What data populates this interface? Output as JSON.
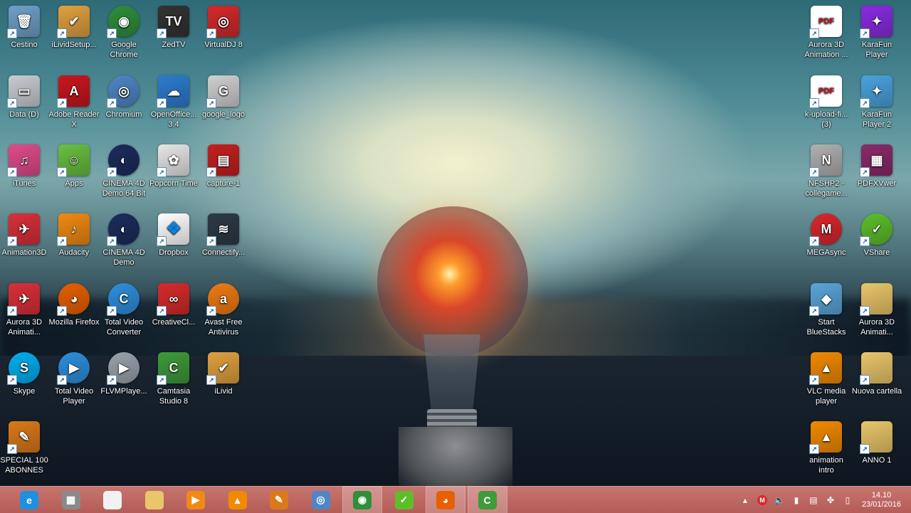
{
  "desktop": {
    "left_icons": [
      {
        "label": "Cestino",
        "icon": "recycle-bin-icon",
        "color": "#6fa0c8"
      },
      {
        "label": "iLividSetup...",
        "icon": "ilivid-icon",
        "color": "#e0a040"
      },
      {
        "label": "Google Chrome",
        "icon": "chrome-icon",
        "color": "#2f8f3a"
      },
      {
        "label": "ZedTV",
        "icon": "zedtv-icon",
        "color": "#333333"
      },
      {
        "label": "VirtualDJ 8",
        "icon": "virtualdj-icon",
        "color": "#d42a2a"
      },
      {
        "label": "Data (D)",
        "icon": "drive-icon",
        "color": "#c8ccd2"
      },
      {
        "label": "Adobe Reader X",
        "icon": "adobe-reader-icon",
        "color": "#c8171e"
      },
      {
        "label": "Chromium",
        "icon": "chromium-icon",
        "color": "#4f86c6"
      },
      {
        "label": "OpenOffice... 3.4",
        "icon": "openoffice-icon",
        "color": "#2d7ccf"
      },
      {
        "label": "google_logo",
        "icon": "image-file-icon",
        "color": "#d0d0d0"
      },
      {
        "label": "iTunes",
        "icon": "itunes-icon",
        "color": "#e04c8a"
      },
      {
        "label": "Apps",
        "icon": "android-apps-icon",
        "color": "#6abf3f"
      },
      {
        "label": "CINEMA 4D Demo 64 Bit",
        "icon": "cinema4d-icon",
        "color": "#1c2c5c"
      },
      {
        "label": "Popcorn Time",
        "icon": "popcorn-icon",
        "color": "#e6e6e6"
      },
      {
        "label": "capture-1",
        "icon": "video-file-icon",
        "color": "#c42020"
      },
      {
        "label": "Animation3D",
        "icon": "animation3d-icon",
        "color": "#d9303a"
      },
      {
        "label": "Audacity",
        "icon": "audacity-icon",
        "color": "#f08a12"
      },
      {
        "label": "CINEMA 4D Demo",
        "icon": "cinema4d-icon",
        "color": "#1c2c5c"
      },
      {
        "label": "Dropbox",
        "icon": "dropbox-icon",
        "color": "#ffffff"
      },
      {
        "label": "Connectify...",
        "icon": "connectify-icon",
        "color": "#2e3a46"
      },
      {
        "label": "Aurora 3D Animati...",
        "icon": "aurora3d-icon",
        "color": "#d9303a"
      },
      {
        "label": "Mozilla Firefox",
        "icon": "firefox-icon",
        "color": "#e66000"
      },
      {
        "label": "Total Video Converter",
        "icon": "total-video-converter-icon",
        "color": "#2e8fdc"
      },
      {
        "label": "CreativeCl...",
        "icon": "creative-cloud-icon",
        "color": "#d62b2b"
      },
      {
        "label": "Avast Free Antivirus",
        "icon": "avast-icon",
        "color": "#f07a13"
      },
      {
        "label": "Skype",
        "icon": "skype-icon",
        "color": "#00aff0"
      },
      {
        "label": "Total Video Player",
        "icon": "total-video-player-icon",
        "color": "#2e8fdc"
      },
      {
        "label": "FLVMPlaye...",
        "icon": "flv-player-icon",
        "color": "#9aa3ad"
      },
      {
        "label": "Camtasia Studio 8",
        "icon": "camtasia-icon",
        "color": "#3e9b3a"
      },
      {
        "label": "iLivid",
        "icon": "ilivid-icon",
        "color": "#e0a040"
      },
      {
        "label": "SPECIAL 100 ABONNES",
        "icon": "video-tool-icon",
        "color": "#d97a1a"
      }
    ],
    "right_icons": [
      {
        "label": "Aurora 3D Animation ...",
        "icon": "pdf-file-icon",
        "color": "#c8171e"
      },
      {
        "label": "KaraFun Player",
        "icon": "karafun-icon",
        "color": "#8a2be2"
      },
      {
        "label": "k-upload-fi... (3)",
        "icon": "pdf-file-icon",
        "color": "#c8171e"
      },
      {
        "label": "KaraFun Player 2",
        "icon": "karafun-icon",
        "color": "#4aa3df"
      },
      {
        "label": "NFSHP2 - collegame...",
        "icon": "nfs-icon",
        "color": "#b0b0b0"
      },
      {
        "label": "PDFXVwer",
        "icon": "winrar-icon",
        "color": "#8b2a6a"
      },
      {
        "label": "MEGAsync",
        "icon": "mega-icon",
        "color": "#d9272e"
      },
      {
        "label": "VShare",
        "icon": "vshare-icon",
        "color": "#5cbf2a"
      },
      {
        "label": "Start BlueStacks",
        "icon": "bluestacks-icon",
        "color": "#5aa5d9"
      },
      {
        "label": "Aurora 3D Animati...",
        "icon": "folder-icon",
        "color": "#e8c66a"
      },
      {
        "label": "VLC media player",
        "icon": "vlc-icon",
        "color": "#f18a00"
      },
      {
        "label": "Nuova cartella",
        "icon": "folder-icon",
        "color": "#e8c66a"
      },
      {
        "label": "animation intro",
        "icon": "vlc-icon",
        "color": "#f18a00"
      },
      {
        "label": "ANNO 1",
        "icon": "folder-icon",
        "color": "#e8c66a"
      }
    ]
  },
  "taskbar": {
    "color": "#b85f5a",
    "buttons": [
      {
        "icon": "internet-explorer-icon",
        "color": "#1e90e0",
        "glyph": "e",
        "active": false
      },
      {
        "icon": "control-panel-icon",
        "color": "#8a8a8a",
        "glyph": "▦",
        "active": false
      },
      {
        "icon": "document-icon",
        "color": "#f2f2f2",
        "glyph": "",
        "active": false
      },
      {
        "icon": "file-explorer-icon",
        "color": "#e8c66a",
        "glyph": "",
        "active": false
      },
      {
        "icon": "media-player-icon",
        "color": "#f08a12",
        "glyph": "▶",
        "active": false
      },
      {
        "icon": "vlc-icon",
        "color": "#f18a00",
        "glyph": "▲",
        "active": false
      },
      {
        "icon": "video-tool-icon",
        "color": "#d97a1a",
        "glyph": "✎",
        "active": false
      },
      {
        "icon": "chromium-icon",
        "color": "#4f86c6",
        "glyph": "◎",
        "active": false
      },
      {
        "icon": "chrome-icon",
        "color": "#2f8f3a",
        "glyph": "◉",
        "active": true
      },
      {
        "icon": "vshare-icon",
        "color": "#5cbf2a",
        "glyph": "✓",
        "active": false
      },
      {
        "icon": "firefox-icon",
        "color": "#e66000",
        "glyph": "◕",
        "active": true
      },
      {
        "icon": "camtasia-icon",
        "color": "#3e9b3a",
        "glyph": "C",
        "active": true
      }
    ],
    "tray": {
      "icons": [
        "chevron-up-icon",
        "mega-icon",
        "speaker-icon",
        "signal-icon",
        "network-icon",
        "bluestacks-tray-icon",
        "battery-icon"
      ],
      "time": "14.10",
      "date": "23/01/2016"
    }
  }
}
